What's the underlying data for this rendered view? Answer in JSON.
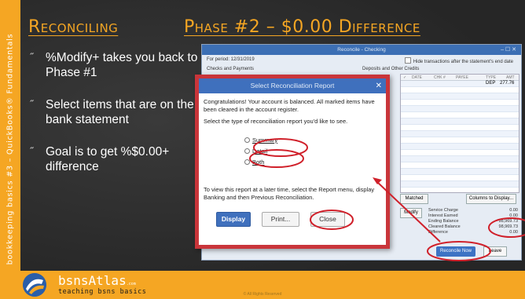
{
  "sidebar": {
    "text": "bookkeeping basics #3 – QuickBooks® Fundamentals"
  },
  "title": {
    "left": "Reconciling",
    "right": "Phase #2 – $0.00 Difference"
  },
  "bullets": [
    {
      "mark": "˝",
      "text": "%Modify+ takes you back to Phase #1"
    },
    {
      "mark": "˝",
      "text": "Select items that are on the bank statement"
    },
    {
      "mark": "˝",
      "text": "Goal is to get %$0.00+ difference"
    }
  ],
  "qb": {
    "window_title": "Reconcile - Checking",
    "window_controls": "– ☐ ✕",
    "period": "For period: 12/31/2019",
    "hide_label": "Hide transactions after the statement's end date",
    "checks_label": "Checks and Payments",
    "deposits_label": "Deposits and Other Credits",
    "columns": [
      "✓",
      "DATE",
      "CHK #",
      "PAYEE",
      "TYPE",
      "AMT"
    ],
    "row": {
      "type": "DEP",
      "amount": "277.76"
    },
    "matched_label": "Matched",
    "columns_button": "Columns to Display...",
    "modify_label": "Modify",
    "summary": [
      {
        "label": "Service Charge",
        "value": "0.00"
      },
      {
        "label": "Interest Earned",
        "value": "0.00"
      },
      {
        "label": "Ending Balance",
        "value": "98,969.73"
      },
      {
        "label": "Cleared Balance",
        "value": "98,969.73"
      },
      {
        "label": "Difference",
        "value": "0.00"
      }
    ],
    "reconcile_now": "Reconcile Now",
    "leave": "Leave"
  },
  "dialog": {
    "title": "Select Reconciliation Report",
    "close_glyph": "✕",
    "message": "Congratulations! Your account is balanced. All marked items have been cleared in the account register.",
    "prompt": "Select the type of reconciliation report you'd like to see.",
    "options": [
      "Summary",
      "Detail",
      "Both"
    ],
    "footnote": "To view this report at a later time, select the Report menu, display Banking and then Previous Reconciliation.",
    "buttons": {
      "display": "Display",
      "print": "Print...",
      "close": "Close"
    }
  },
  "footer": {
    "brand": "bsnsAtlas",
    "brand_suffix": ".com",
    "tagline": "teaching bsns basics",
    "rights": "© All Rights Reserved"
  },
  "colors": {
    "accent": "#f5a623",
    "annotation": "#d0202a",
    "qb_blue": "#3f70bd"
  }
}
